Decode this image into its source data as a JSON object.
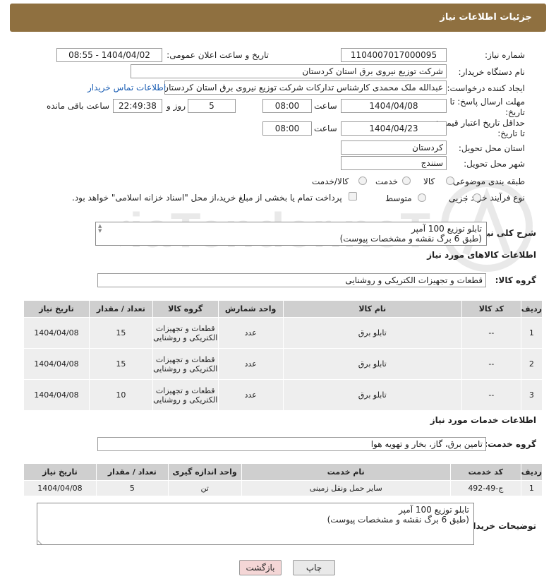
{
  "header": {
    "title": "جزئیات اطلاعات نیاز"
  },
  "form": {
    "need_number_label": "شماره نیاز:",
    "need_number": "1104007017000095",
    "announce_label": "تاریخ و ساعت اعلان عمومی:",
    "announce_value": "1404/04/02 - 08:55",
    "buyer_org_label": "نام دستگاه خریدار:",
    "buyer_org": "شرکت توزیع نیروی برق استان کردستان",
    "creator_label": "ایجاد کننده درخواست:",
    "creator": "عبدالله ملک محمدی کارشناس تدارکات شرکت توزیع نیروی برق استان کردستان",
    "contact_link": "اطلاعات تماس خریدار",
    "deadline_label": "مهلت ارسال پاسخ: تا تاریخ:",
    "deadline_date": "1404/04/08",
    "time_label": "ساعت",
    "deadline_time": "08:00",
    "days_value": "5",
    "days_label": "روز و",
    "remaining_time": "22:49:38",
    "remaining_label": "ساعت باقی مانده",
    "price_validity_label": "حداقل تاریخ اعتبار قیمت: تا تاریخ:",
    "price_validity_date": "1404/04/23",
    "price_validity_time": "08:00",
    "province_label": "استان محل تحویل:",
    "province": "کردستان",
    "city_label": "شهر محل تحویل:",
    "city": "سنندج",
    "category_label": "طبقه بندی موضوعی:",
    "category_options": [
      "کالا",
      "خدمت",
      "کالا/خدمت"
    ],
    "purchase_type_label": "نوع فرآیند خرید :",
    "purchase_options": [
      "جزیی",
      "متوسط"
    ],
    "payment_note": "پرداخت تمام یا بخشی از مبلغ خرید،از محل \"اسناد خزانه اسلامی\" خواهد بود.",
    "summary_label": "شرح کلی نیاز:",
    "summary_text_line1": "تابلو توزیع 100 آمپر",
    "summary_text_line2": "(طبق 6 برگ نقشه و مشخصات پیوست)"
  },
  "goods": {
    "section_title": "اطلاعات کالاهای مورد نیاز",
    "group_label": "گروه کالا:",
    "group_value": "قطعات و تجهیزات الکتریکی و روشنایی",
    "columns": [
      "ردیف",
      "کد کالا",
      "نام کالا",
      "واحد شمارش",
      "گروه کالا",
      "تعداد / مقدار",
      "تاریخ نیاز"
    ],
    "rows": [
      {
        "row": "1",
        "code": "--",
        "name": "تابلو برق",
        "unit": "عدد",
        "group": "قطعات و تجهیزات الکتریکی و روشنایی",
        "qty": "15",
        "date": "1404/04/08"
      },
      {
        "row": "2",
        "code": "--",
        "name": "تابلو برق",
        "unit": "عدد",
        "group": "قطعات و تجهیزات الکتریکی و روشنایی",
        "qty": "15",
        "date": "1404/04/08"
      },
      {
        "row": "3",
        "code": "--",
        "name": "تابلو برق",
        "unit": "عدد",
        "group": "قطعات و تجهیزات الکتریکی و روشنایی",
        "qty": "10",
        "date": "1404/04/08"
      }
    ]
  },
  "services": {
    "section_title": "اطلاعات خدمات مورد نیاز",
    "group_label": "گروه خدمت:",
    "group_value": "تامین برق، گاز، بخار و تهویه هوا",
    "columns": [
      "ردیف",
      "کد خدمت",
      "نام خدمت",
      "واحد اندازه گیری",
      "تعداد / مقدار",
      "تاریخ نیاز"
    ],
    "rows": [
      {
        "row": "1",
        "code": "ج-49-492",
        "name": "سایر حمل ونقل زمینی",
        "unit": "تن",
        "qty": "5",
        "date": "1404/04/08"
      }
    ]
  },
  "buyer_notes": {
    "label": "توضیحات خریدار:",
    "line1": "تابلو توزیع 100 آمپر",
    "line2": "(طبق 6 برگ نقشه و مشخصات پیوست)"
  },
  "buttons": {
    "print": "چاپ",
    "back": "بازگشت"
  },
  "watermark": {
    "text": "AriaTender.neT"
  }
}
